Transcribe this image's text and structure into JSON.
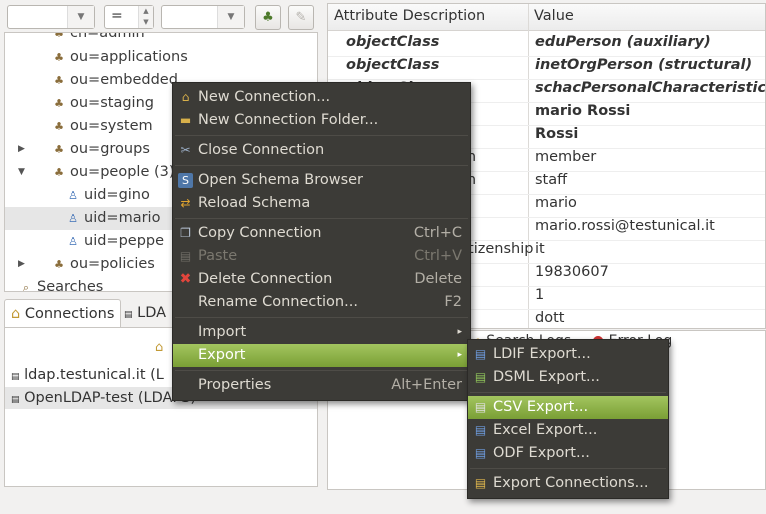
{
  "toolbar": {
    "filter_value": "",
    "operator": "=",
    "value": ""
  },
  "tree": {
    "items": [
      {
        "label": "cn=admin",
        "indent": 1
      },
      {
        "label": "ou=applications",
        "indent": 1
      },
      {
        "label": "ou=embedded",
        "indent": 1
      },
      {
        "label": "ou=staging",
        "indent": 1
      },
      {
        "label": "ou=system",
        "indent": 1
      },
      {
        "label": "ou=groups",
        "indent": 1
      },
      {
        "label": "ou=people (3)",
        "indent": 1
      },
      {
        "label": "uid=gino",
        "indent": 2
      },
      {
        "label": "uid=mario",
        "indent": 2
      },
      {
        "label": "uid=peppe",
        "indent": 2
      },
      {
        "label": "ou=policies",
        "indent": 1
      },
      {
        "label": "Searches",
        "indent": 0
      }
    ]
  },
  "tabs": {
    "connections": "Connections",
    "ldap": "LDA"
  },
  "connections": [
    {
      "label": "ldap.testunical.it (L"
    },
    {
      "label": "OpenLDAP-test (LDAPS)"
    }
  ],
  "attributes": {
    "header": {
      "desc": "Attribute Description",
      "value": "Value"
    },
    "rows": [
      {
        "desc": "objectClass",
        "value": "eduPerson (auxiliary)",
        "style": "it"
      },
      {
        "desc": "objectClass",
        "value": "inetOrgPerson (structural)",
        "style": "it"
      },
      {
        "desc": "objectClass",
        "value": "schacPersonalCharacteristics (au",
        "style": "it"
      },
      {
        "desc": "",
        "value": "mario Rossi",
        "style": "b"
      },
      {
        "desc": "",
        "value": "Rossi",
        "style": "b"
      },
      {
        "desc": "on",
        "value": "member",
        "style": ""
      },
      {
        "desc": "on",
        "value": "staff",
        "style": ""
      },
      {
        "desc": "",
        "value": "mario",
        "style": ""
      },
      {
        "desc": "",
        "value": "mario.rossi@testunical.it",
        "style": ""
      },
      {
        "desc": "itizenship",
        "value": "it",
        "style": ""
      },
      {
        "desc": "",
        "value": "19830607",
        "style": ""
      },
      {
        "desc": "",
        "value": "1",
        "style": ""
      },
      {
        "desc": "",
        "value": "dott",
        "style": ""
      }
    ]
  },
  "bottom_tabs": {
    "search_logs": "Search Logs",
    "error_log": "Error Log"
  },
  "context_menu": {
    "items": [
      {
        "label": "New Connection...",
        "accel": ""
      },
      {
        "label": "New Connection Folder...",
        "accel": ""
      },
      {
        "label": "Close Connection",
        "accel": ""
      },
      {
        "label": "Open Schema Browser",
        "accel": ""
      },
      {
        "label": "Reload Schema",
        "accel": ""
      },
      {
        "label": "Copy Connection",
        "accel": "Ctrl+C"
      },
      {
        "label": "Paste",
        "accel": "Ctrl+V"
      },
      {
        "label": "Delete Connection",
        "accel": "Delete"
      },
      {
        "label": "Rename Connection...",
        "accel": "F2"
      },
      {
        "label": "Import",
        "accel": ""
      },
      {
        "label": "Export",
        "accel": ""
      },
      {
        "label": "Properties",
        "accel": "Alt+Enter"
      }
    ]
  },
  "export_menu": {
    "items": [
      {
        "label": "LDIF Export..."
      },
      {
        "label": "DSML Export..."
      },
      {
        "label": "CSV Export..."
      },
      {
        "label": "Excel Export..."
      },
      {
        "label": "ODF Export..."
      },
      {
        "label": "Export Connections..."
      }
    ]
  }
}
